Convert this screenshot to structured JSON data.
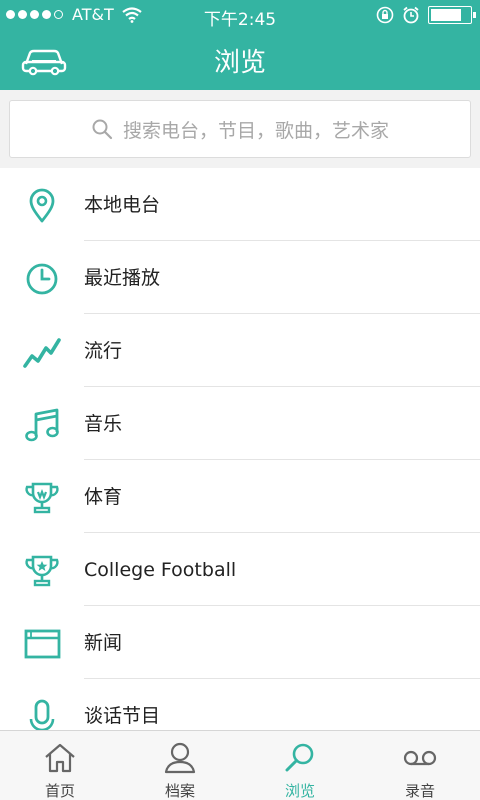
{
  "status_bar": {
    "carrier": "AT&T",
    "time": "下午2:45",
    "battery_level": 0.8
  },
  "nav": {
    "title": "浏览",
    "left_icon": "car-icon"
  },
  "search": {
    "placeholder": "搜索电台，节目，歌曲，艺术家"
  },
  "list": {
    "items": [
      {
        "label": "本地电台",
        "icon": "location-pin-icon"
      },
      {
        "label": "最近播放",
        "icon": "clock-icon"
      },
      {
        "label": "流行",
        "icon": "trending-icon"
      },
      {
        "label": "音乐",
        "icon": "music-note-icon"
      },
      {
        "label": "体育",
        "icon": "trophy-icon"
      },
      {
        "label": "College Football",
        "icon": "trophy-star-icon"
      },
      {
        "label": "新闻",
        "icon": "news-window-icon"
      },
      {
        "label": "谈话节目",
        "icon": "microphone-icon"
      }
    ]
  },
  "tabs": [
    {
      "label": "首页",
      "icon": "home-icon",
      "active": false
    },
    {
      "label": "档案",
      "icon": "profile-icon",
      "active": false
    },
    {
      "label": "浏览",
      "icon": "browse-search-icon",
      "active": true
    },
    {
      "label": "录音",
      "icon": "voicemail-icon",
      "active": false
    }
  ],
  "colors": {
    "accent": "#34b4a2",
    "text": "#222222",
    "placeholder": "#a8a8a8",
    "tab_inactive": "#444444"
  }
}
